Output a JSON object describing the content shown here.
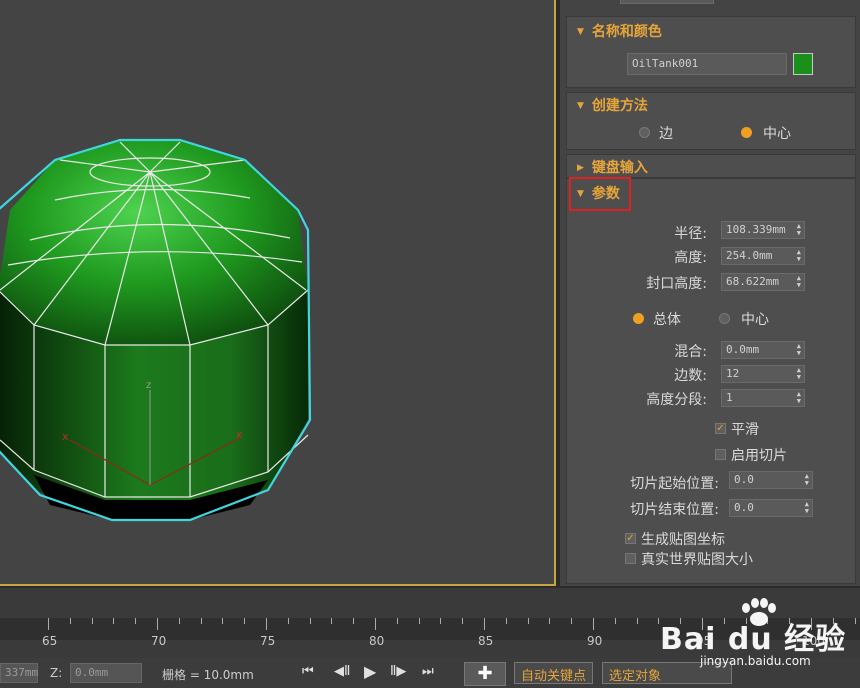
{
  "panel": {
    "name_color": {
      "header": "名称和颜色",
      "name_value": "OilTank001",
      "object_color": "#1a8f1a"
    },
    "creation_method": {
      "header": "创建方法",
      "options": [
        "边",
        "中心"
      ],
      "selected": "中心"
    },
    "keyboard_entry": {
      "header": "键盘输入"
    },
    "parameters": {
      "header": "参数",
      "radius_label": "半径:",
      "radius_value": "108.339mm",
      "height_label": "高度:",
      "height_value": "254.0mm",
      "cap_height_label": "封口高度:",
      "cap_height_value": "68.622mm",
      "mode_overall": "总体",
      "mode_center": "中心",
      "mode_selected": "总体",
      "blend_label": "混合:",
      "blend_value": "0.0mm",
      "sides_label": "边数:",
      "sides_value": "12",
      "height_segs_label": "高度分段:",
      "height_segs_value": "1",
      "smooth_label": "平滑",
      "smooth_checked": true,
      "slice_on_label": "启用切片",
      "slice_on_checked": false,
      "slice_from_label": "切片起始位置:",
      "slice_from_value": "0.0",
      "slice_to_label": "切片结束位置:",
      "slice_to_value": "0.0",
      "gen_map_label": "生成贴图坐标",
      "gen_map_checked": true,
      "real_world_label": "真实世界贴图大小",
      "real_world_checked": false
    }
  },
  "timeline": {
    "ticks": [
      "65",
      "70",
      "75",
      "80",
      "85",
      "90",
      "95",
      "100"
    ]
  },
  "status": {
    "coord_partial": "337mm",
    "z_label": "Z:",
    "z_value": "0.0mm",
    "grid_label": "栅格 = 10.0mm",
    "auto_key_label": "自动关键点",
    "selected_label": "选定对象"
  },
  "watermark": {
    "text": "Bai du 经验",
    "sub": "jingyan.baidu.com"
  },
  "colors": {
    "accent": "#e6a53a",
    "highlight": "#e12020",
    "viewport_frame": "#c9a441",
    "selection": "#3fd6e0",
    "object": "#1a8f1a"
  }
}
